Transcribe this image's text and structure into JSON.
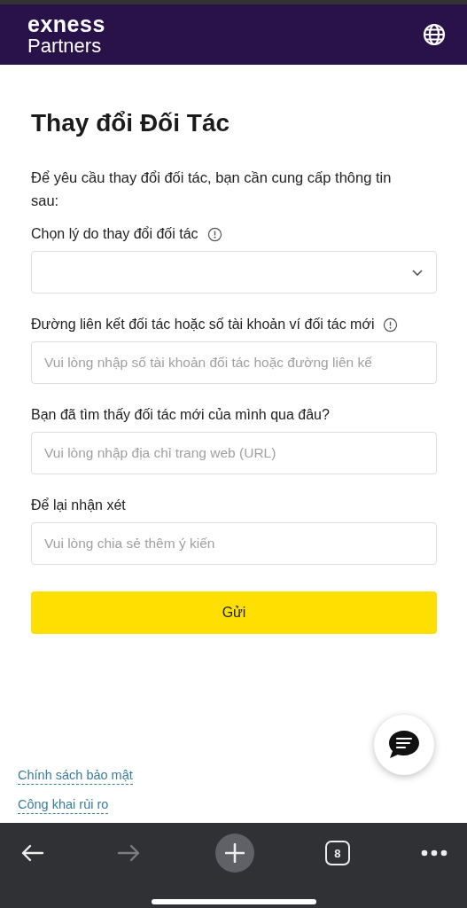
{
  "header": {
    "logo_top": "exness",
    "logo_bottom": "Partners"
  },
  "title": "Thay đổi Đối Tác",
  "intro": "Để yêu cầu thay đổi đối tác, bạn cần cung cấp thông tin sau:",
  "fields": [
    {
      "kind": "select",
      "label": "Chọn lý do thay đổi đối tác",
      "info": true
    },
    {
      "kind": "text",
      "label": "Đường liên kết đối tác hoặc số tài khoản ví đối tác mới",
      "info": true,
      "placeholder": "Vui lòng nhập số tài khoản đối tác hoặc đường liên kế"
    },
    {
      "kind": "text",
      "label": "Bạn đã tìm thấy đối tác mới của mình qua đâu?",
      "info": false,
      "placeholder": "Vui lòng nhập địa chỉ trang web (URL)"
    },
    {
      "kind": "text",
      "label": "Để lại nhận xét",
      "info": false,
      "placeholder": "Vui lòng chia sẻ thêm ý kiến"
    }
  ],
  "submit": "Gửi",
  "footer_links": [
    "Chính sách bảo mật",
    "Công khai rủi ro"
  ],
  "browser_bar": {
    "back_disabled": false,
    "forward_disabled": true,
    "tab_count": "8"
  }
}
